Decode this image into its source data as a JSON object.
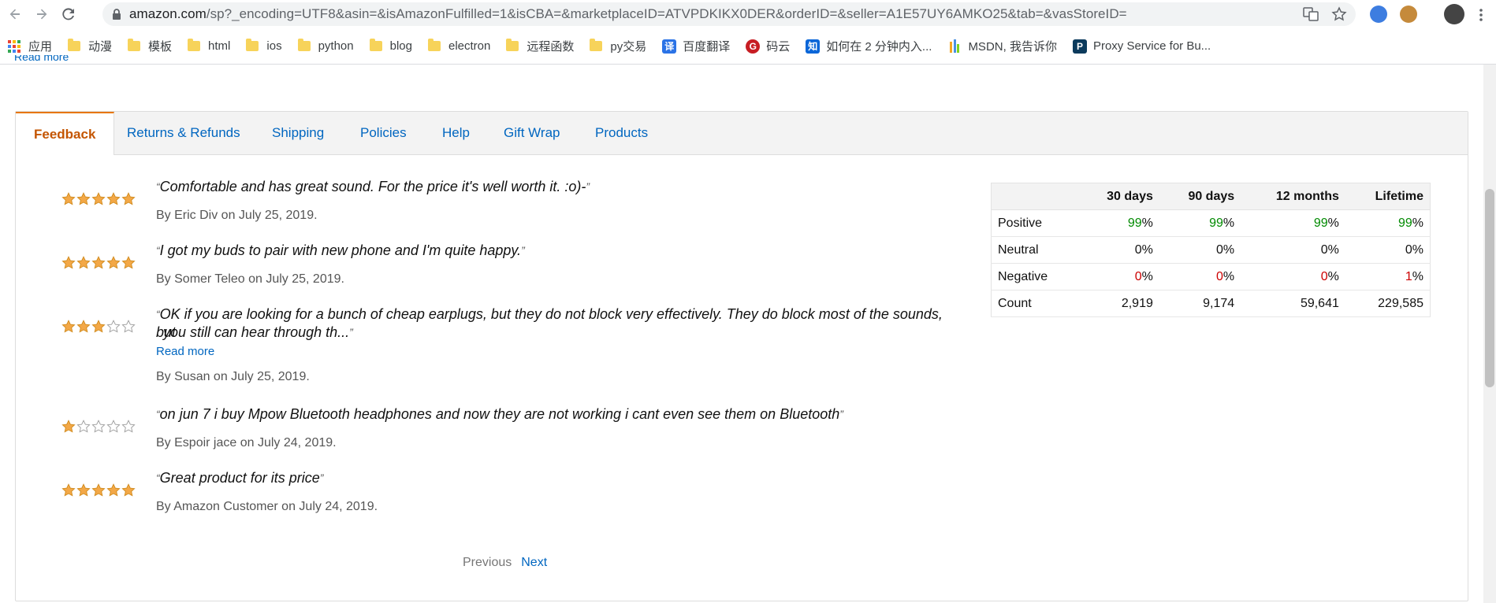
{
  "browser": {
    "url_domain": "amazon.com",
    "url_path": "/sp?_encoding=UTF8&asin=&isAmazonFulfilled=1&isCBA=&marketplaceID=ATVPDKIKX0DER&orderID=&seller=A1E57UY6AMKO25&tab=&vasStoreID=",
    "bookmarks": [
      {
        "label": "应用",
        "icon": "apps-grid-icon"
      },
      {
        "label": "动漫",
        "icon": "folder-icon"
      },
      {
        "label": "模板",
        "icon": "folder-icon"
      },
      {
        "label": "html",
        "icon": "folder-icon"
      },
      {
        "label": "ios",
        "icon": "folder-icon"
      },
      {
        "label": "python",
        "icon": "folder-icon"
      },
      {
        "label": "blog",
        "icon": "folder-icon"
      },
      {
        "label": "electron",
        "icon": "folder-icon"
      },
      {
        "label": "远程函数",
        "icon": "folder-icon"
      },
      {
        "label": "py交易",
        "icon": "folder-icon"
      },
      {
        "label": "百度翻译",
        "icon": "translate-favicon"
      },
      {
        "label": "码云",
        "icon": "gitee-favicon"
      },
      {
        "label": "如何在 2 分钟内入...",
        "icon": "zhihu-favicon"
      },
      {
        "label": "MSDN, 我告诉你",
        "icon": "msdn-favicon"
      },
      {
        "label": "Proxy Service for Bu...",
        "icon": "proxy-favicon"
      }
    ],
    "bookmark_glyphs": {
      "translate": "译",
      "gitee": "G",
      "zhihu": "知",
      "proxy": "P"
    }
  },
  "page": {
    "partial_link": "Read more",
    "tabs": [
      "Feedback",
      "Returns & Refunds",
      "Shipping",
      "Policies",
      "Help",
      "Gift Wrap",
      "Products"
    ],
    "reviews": [
      {
        "stars": 5,
        "text": "Comfortable and has great sound. For the price it's well worth it. :o)-",
        "by": "By Eric Div on July 25, 2019."
      },
      {
        "stars": 5,
        "text": "I got my buds to pair with new phone and I'm quite happy.",
        "by": "By Somer Teleo on July 25, 2019."
      },
      {
        "stars": 3,
        "text_line1": "OK if you are looking for a bunch of cheap earplugs, but they do not block very effectively. They do block most of the sounds, but",
        "text_line2": "you still can hear through th...",
        "read_more": "Read more",
        "by": "By Susan on July 25, 2019."
      },
      {
        "stars": 1,
        "text": "on jun 7 i buy Mpow Bluetooth headphones and now they are not working i cant even see them on Bluetooth",
        "by": "By Espoir jace on July 24, 2019."
      },
      {
        "stars": 5,
        "text": "Great product for its price",
        "by": "By Amazon Customer on July 24, 2019."
      }
    ],
    "quote_open": "“",
    "quote_close": "”",
    "stats": {
      "headers": [
        "",
        "30 days",
        "90 days",
        "12 months",
        "Lifetime"
      ],
      "rows": [
        {
          "label": "Positive",
          "values": [
            "99",
            "99",
            "99",
            "99"
          ],
          "suffix": "%"
        },
        {
          "label": "Neutral",
          "values": [
            "0%",
            "0%",
            "0%",
            "0%"
          ]
        },
        {
          "label": "Negative",
          "values": [
            "0",
            "0",
            "0",
            "1"
          ],
          "suffix": "%"
        },
        {
          "label": "Count",
          "values": [
            "2,919",
            "9,174",
            "59,641",
            "229,585"
          ]
        }
      ]
    },
    "pager": {
      "previous": "Previous",
      "next": "Next"
    }
  },
  "colors": {
    "link": "#0066c0",
    "active_tab": "#c45500",
    "star": "#f3a847",
    "positive": "#008a00",
    "negative": "#cc0000"
  }
}
